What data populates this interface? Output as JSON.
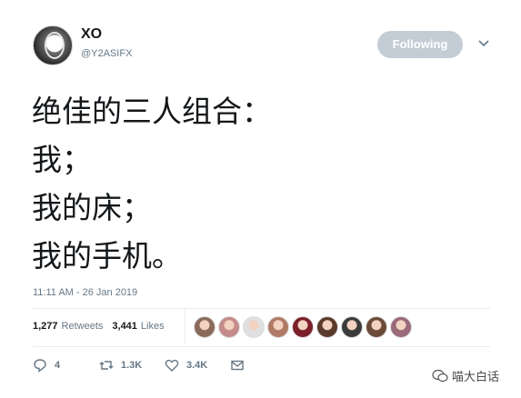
{
  "author": {
    "name": "XO",
    "handle": "@Y2ASIFX"
  },
  "follow_button_label": "Following",
  "tweet": {
    "lines": [
      "绝佳的三人组合：",
      "我；",
      "我的床；",
      "我的手机。"
    ],
    "timestamp": "11:11 AM - 26 Jan 2019"
  },
  "stats": {
    "retweets_count": "1,277",
    "retweets_label": "Retweets",
    "likes_count": "3,441",
    "likes_label": "Likes"
  },
  "liker_avatar_colors": [
    "#8a6a5a",
    "#c58b8b",
    "#e0e0e0",
    "#b07a66",
    "#7b1f2a",
    "#5a3a2a",
    "#3b3b3b",
    "#6b4a3a",
    "#9a6a7a"
  ],
  "actions": {
    "replies": "4",
    "retweets": "1.3K",
    "likes": "3.4K"
  },
  "watermark": {
    "text": "喵大白话"
  },
  "icons": [
    "chevron-down-icon",
    "reply-icon",
    "retweet-icon",
    "like-icon",
    "message-icon",
    "wechat-icon"
  ]
}
